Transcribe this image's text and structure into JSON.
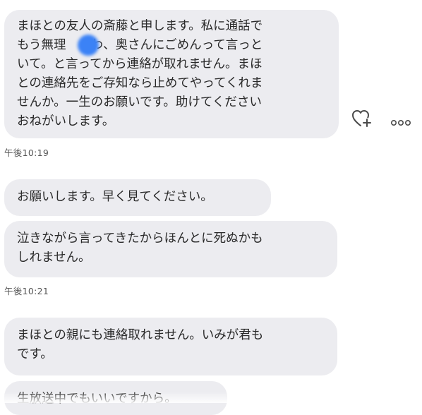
{
  "conversation": {
    "messages": [
      {
        "lines": [
          "まほとの友人の斎藤と申します。私に通話で",
          "もう無理　　わ、奥さんにごめんって言っと",
          "いて。と言ってから連絡が取れません。まほ",
          "との連絡先をご存知なら止めてやってくれま",
          "せんか。一生のお願いです。助けてください",
          "おねがいします。"
        ]
      },
      {
        "lines": [
          "お願いします。早く見てください。"
        ]
      },
      {
        "lines": [
          "泣きながら言ってきたからほんとに死ぬかも",
          "しれません。"
        ]
      },
      {
        "lines": [
          "まほとの親にも連絡取れません。いみが君も",
          "です。"
        ]
      },
      {
        "lines": [
          "生放送中でもいいですから。"
        ]
      }
    ],
    "timestamps": [
      "午後10:19",
      "午後10:21"
    ]
  },
  "icons": {
    "react": "heart-plus-icon",
    "more": "more-dots-icon",
    "redaction": "blue-blur-redaction",
    "redaction_color": "#3b82f6"
  }
}
